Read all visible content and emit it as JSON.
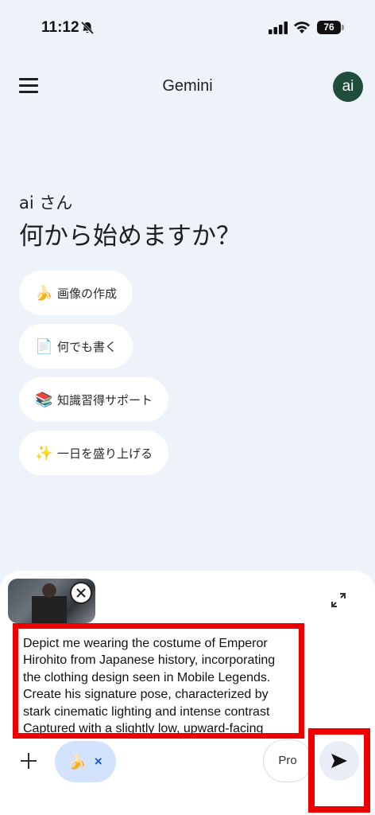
{
  "status_bar": {
    "time": "11:12",
    "battery": "76"
  },
  "header": {
    "title": "Gemini",
    "avatar_initials": "ai"
  },
  "greeting": {
    "name_line": "ai さん",
    "question": "何から始めますか？"
  },
  "chips": [
    {
      "emoji": "🍌",
      "label": "画像の作成"
    },
    {
      "emoji": "📄",
      "label": "何でも書く"
    },
    {
      "emoji": "📚",
      "label": "知識習得サポート"
    },
    {
      "emoji": "✨",
      "label": "一日を盛り上げる"
    }
  ],
  "composer": {
    "prompt_text": "Depict me wearing the costume of Emperor Hirohito from Japanese history, incorporating the clothing design seen in Mobile Legends. Create his signature pose, characterized by stark cinematic lighting and intense contrast Captured with a slightly low, upward-facing",
    "tool_chip_emoji": "🍌",
    "tool_chip_close": "×",
    "mode_label": "Pro"
  },
  "colors": {
    "background": "#eef2f9",
    "avatar": "#1e4d3b",
    "tool_chip": "#d3e3fd",
    "highlight": "#ee0000"
  },
  "icons": [
    "bell-off-icon",
    "signal-icon",
    "wifi-icon",
    "menu-icon",
    "close-icon",
    "expand-icon",
    "plus-icon",
    "send-icon"
  ]
}
